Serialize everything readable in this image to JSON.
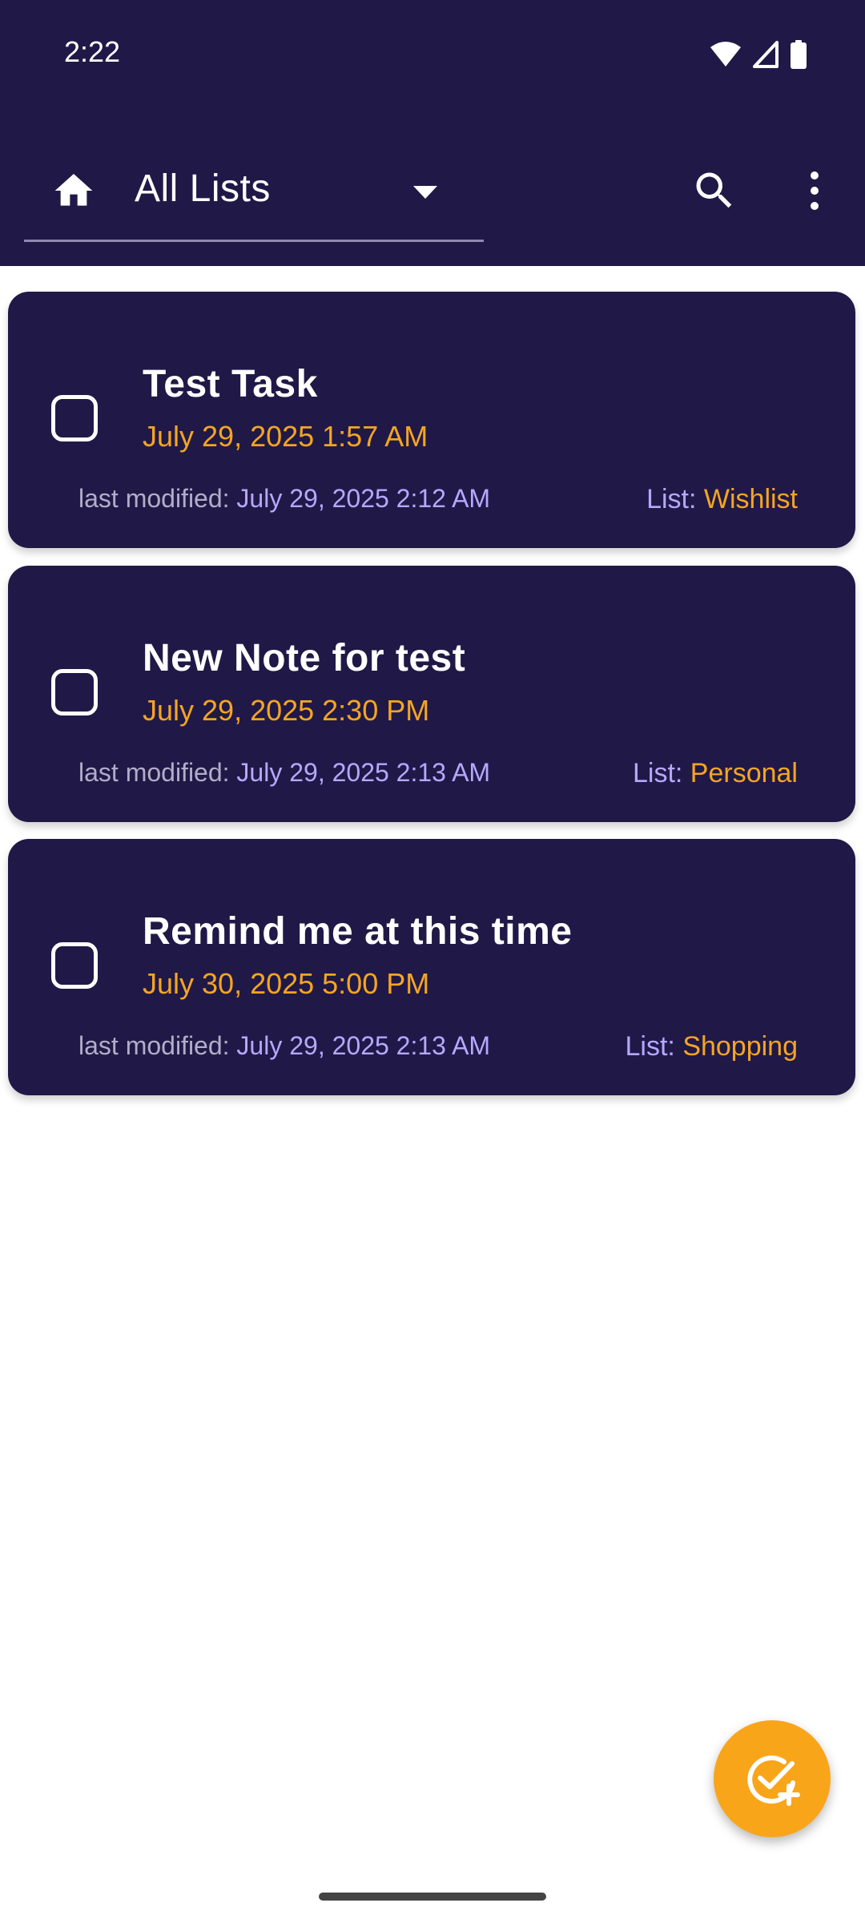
{
  "status_bar": {
    "time": "2:22"
  },
  "app_bar": {
    "list_selector_label": "All Lists"
  },
  "tasks": [
    {
      "title": "Test Task",
      "due": "July 29, 2025 1:57 AM",
      "last_modified_label": "last modified:",
      "last_modified_value": "July 29, 2025 2:12 AM",
      "list_label": "List:",
      "list_name": "Wishlist",
      "checked": false
    },
    {
      "title": "New Note for test",
      "due": "July 29, 2025 2:30 PM",
      "last_modified_label": "last modified:",
      "last_modified_value": "July 29, 2025 2:13 AM",
      "list_label": "List:",
      "list_name": "Personal",
      "checked": false
    },
    {
      "title": "Remind me at this time",
      "due": "July 30, 2025 5:00 PM",
      "last_modified_label": "last modified:",
      "last_modified_value": "July 29, 2025 2:13 AM",
      "list_label": "List:",
      "list_name": "Shopping",
      "checked": false
    }
  ],
  "fab": {
    "icon": "add-task-icon"
  },
  "colors": {
    "primary": "#201947",
    "accent": "#f9a51a",
    "due_text": "#f4a523",
    "meta_text": "#b7a7ff"
  }
}
